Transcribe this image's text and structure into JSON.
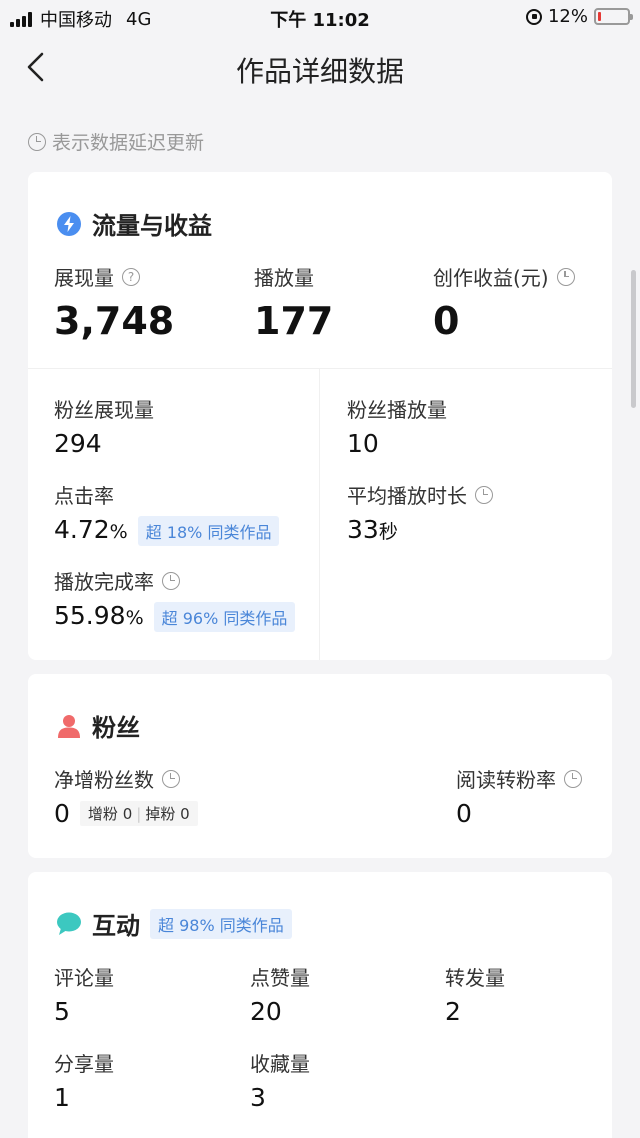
{
  "status_bar": {
    "carrier": "中国移动",
    "network": "4G",
    "time": "下午 11:02",
    "battery": "12%",
    "battery_level": 0.12
  },
  "nav": {
    "title": "作品详细数据",
    "back_icon": "chevron-left-icon"
  },
  "notice": "表示数据延迟更新",
  "traffic": {
    "title": "流量与收益",
    "icon": "lightning-icon",
    "icon_color": "#4a8ef0",
    "impressions_label": "展现量",
    "impressions_value": "3,748",
    "plays_label": "播放量",
    "plays_value": "177",
    "earnings_label": "创作收益(元)",
    "earnings_value": "0",
    "fan_impressions_label": "粉丝展现量",
    "fan_impressions_value": "294",
    "fan_plays_label": "粉丝播放量",
    "fan_plays_value": "10",
    "ctr_label": "点击率",
    "ctr_value": "4.72",
    "ctr_unit": "%",
    "ctr_badge": "超 18% 同类作品",
    "avg_duration_label": "平均播放时长",
    "avg_duration_value": "33",
    "avg_duration_unit": "秒",
    "completion_label": "播放完成率",
    "completion_value": "55.98",
    "completion_unit": "%",
    "completion_badge": "超 96% 同类作品"
  },
  "fans": {
    "title": "粉丝",
    "icon": "person-icon",
    "icon_color": "#f06a6a",
    "net_label": "净增粉丝数",
    "net_value": "0",
    "gain_label": "增粉",
    "gain_value": "0",
    "loss_label": "掉粉",
    "loss_value": "0",
    "conversion_label": "阅读转粉率",
    "conversion_value": "0"
  },
  "interaction": {
    "title": "互动",
    "icon": "chat-bubble-icon",
    "icon_color": "#3cc8c0",
    "badge": "超 98% 同类作品",
    "comments_label": "评论量",
    "comments_value": "5",
    "likes_label": "点赞量",
    "likes_value": "20",
    "reposts_label": "转发量",
    "reposts_value": "2",
    "shares_label": "分享量",
    "shares_value": "1",
    "favorites_label": "收藏量",
    "favorites_value": "3"
  }
}
